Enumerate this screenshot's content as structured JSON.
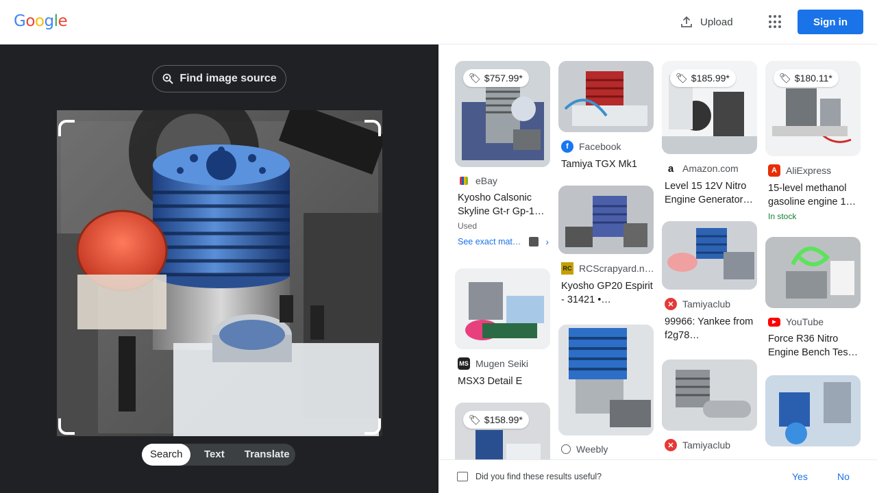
{
  "header": {
    "logo_letters": [
      "G",
      "o",
      "o",
      "g",
      "l",
      "e"
    ],
    "logo_colors": [
      "#4285f4",
      "#ea4335",
      "#fbbc05",
      "#4285f4",
      "#34a853",
      "#ea4335"
    ],
    "upload_label": "Upload",
    "upload_icon": "upload-icon",
    "apps_icon": "apps-grid-icon",
    "signin_label": "Sign in",
    "accent": "#1a73e8"
  },
  "left_panel": {
    "find_source_label": "Find image source",
    "find_source_icon": "lens-search-icon",
    "modes": [
      "Search",
      "Text",
      "Translate"
    ],
    "active_mode": "Search"
  },
  "results": [
    {
      "price": "$757.99*",
      "source": "eBay",
      "title": "Kyosho Calsonic Skyline Gt-r Gp-1…",
      "sub": "Used",
      "exact_label": "See exact mat…"
    },
    {
      "price": "",
      "source": "Mugen Seiki",
      "title": "MSX3 Detail E"
    },
    {
      "price": "$158.99*",
      "source": "",
      "title": ""
    },
    {
      "price": "",
      "source": "Facebook",
      "title": "Tamiya TGX Mk1"
    },
    {
      "price": "",
      "source": "RCScrapyard.n…",
      "title": "Kyosho GP20 Espirit - 31421 •…"
    },
    {
      "price": "",
      "source": "Weebly",
      "title": ""
    },
    {
      "price": "$185.99*",
      "source": "Amazon.com",
      "title": "Level 15 12V Nitro Engine Generator…"
    },
    {
      "price": "",
      "source": "Tamiyaclub",
      "title": "99966: Yankee from f2g78…"
    },
    {
      "price": "",
      "source": "Tamiyaclub",
      "title": ""
    },
    {
      "price": "$180.11*",
      "source": "AliExpress",
      "title": "15-level methanol gasoline engine 1…",
      "sub": "In stock"
    },
    {
      "price": "",
      "source": "YouTube",
      "title": "Force R36 Nitro Engine Bench Tes…"
    }
  ],
  "footer": {
    "question": "Did you find these results useful?",
    "yes_label": "Yes",
    "no_label": "No"
  }
}
